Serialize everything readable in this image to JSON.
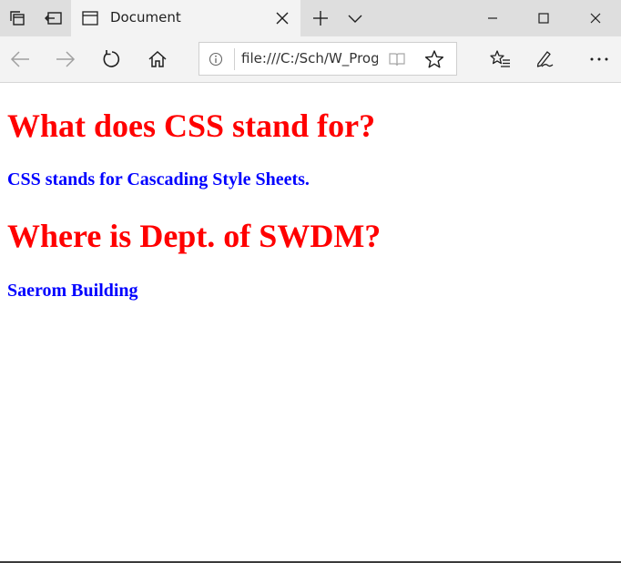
{
  "browser": {
    "tab": {
      "title": "Document"
    },
    "address_bar": {
      "url": "file:///C:/Sch/W_Prog"
    },
    "colors": {
      "titlebar": "#dedede",
      "toolbar": "#f3f3f3",
      "icon": "#1f1f1f",
      "icon_disabled": "#a0a0a0"
    },
    "icons": {
      "tab_actions": "tab-actions-icon",
      "set_aside": "set-aside-tabs-icon",
      "favicon": "document-page-icon",
      "close_tab": "close-icon",
      "new_tab": "plus-icon",
      "tab_preview": "chevron-down-icon",
      "minimize": "minimize-icon",
      "maximize": "maximize-icon",
      "close_window": "close-icon",
      "back": "arrow-left-icon",
      "forward": "arrow-right-icon",
      "refresh": "refresh-icon",
      "home": "home-icon",
      "info": "info-icon",
      "reading_view": "book-icon",
      "favorite": "star-icon",
      "favorites": "favorites-list-icon",
      "notes": "pen-icon",
      "more": "ellipsis-icon"
    }
  },
  "page": {
    "sections": [
      {
        "question": "What does CSS stand for?",
        "answer": "CSS stands for Cascading Style Sheets."
      },
      {
        "question": "Where is Dept. of SWDM?",
        "answer": "Saerom Building"
      }
    ],
    "colors": {
      "question": "#ff0000",
      "answer": "#0000ff"
    }
  }
}
